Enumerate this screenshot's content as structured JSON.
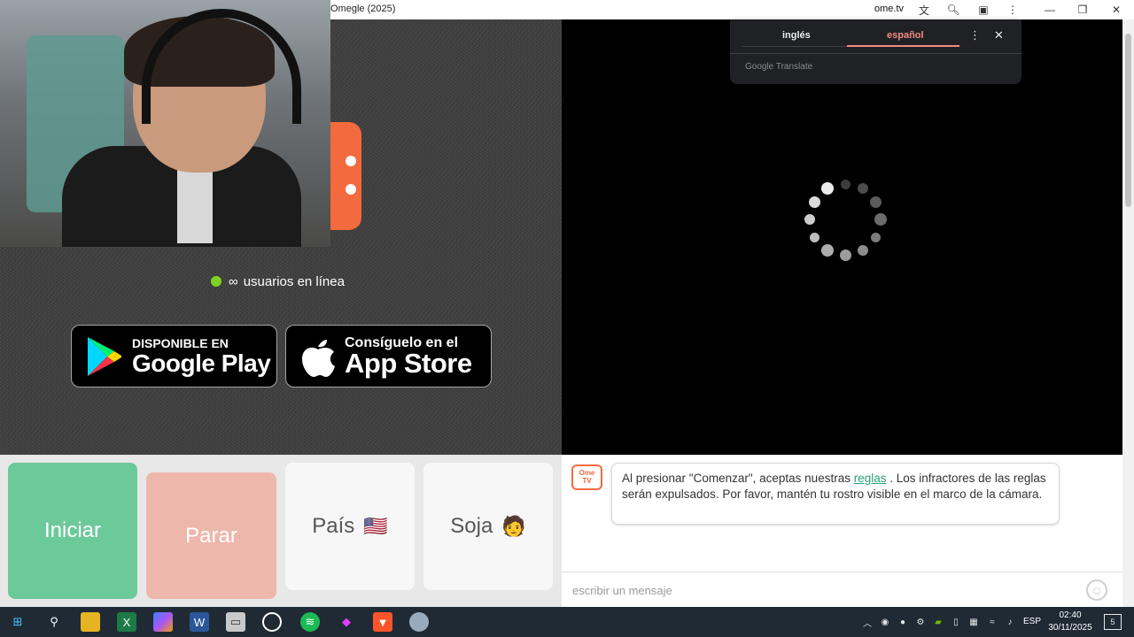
{
  "window": {
    "title": "Omegle (2025)",
    "domain": "ome.tv"
  },
  "video": {
    "online_count": "∞",
    "online_label": "usuarios en línea"
  },
  "badges": {
    "google_play_small": "DISPONIBLE EN",
    "google_play_big": "Google Play",
    "app_store_small": "Consíguelo en el",
    "app_store_big": "App Store"
  },
  "translate": {
    "tab_source": "inglés",
    "tab_target": "español",
    "footer": "Google Translate",
    "active_color": "#f28b82"
  },
  "controls": {
    "start_label": "Iniciar",
    "stop_label": "Parar",
    "country_label": "País",
    "country_flag": "🇺🇸",
    "gender_label": "Soja",
    "gender_emoji": "🧑",
    "start_color": "#6cc99a",
    "stop_color": "#eeb7ac"
  },
  "chat": {
    "logo_line1": "Ome",
    "logo_line2": "TV",
    "msg_before": "Al presionar \"Comenzar\", aceptas nuestras",
    "msg_link": "reglas",
    "msg_after": ". Los infractores de las reglas serán expulsados. Por favor, mantén tu rostro visible en el marco de la cámara.",
    "input_placeholder": "escribir un mensaje"
  },
  "taskbar": {
    "language": "ESP",
    "time": "02:40",
    "date": "30/11/2025",
    "notification_count": "5"
  }
}
